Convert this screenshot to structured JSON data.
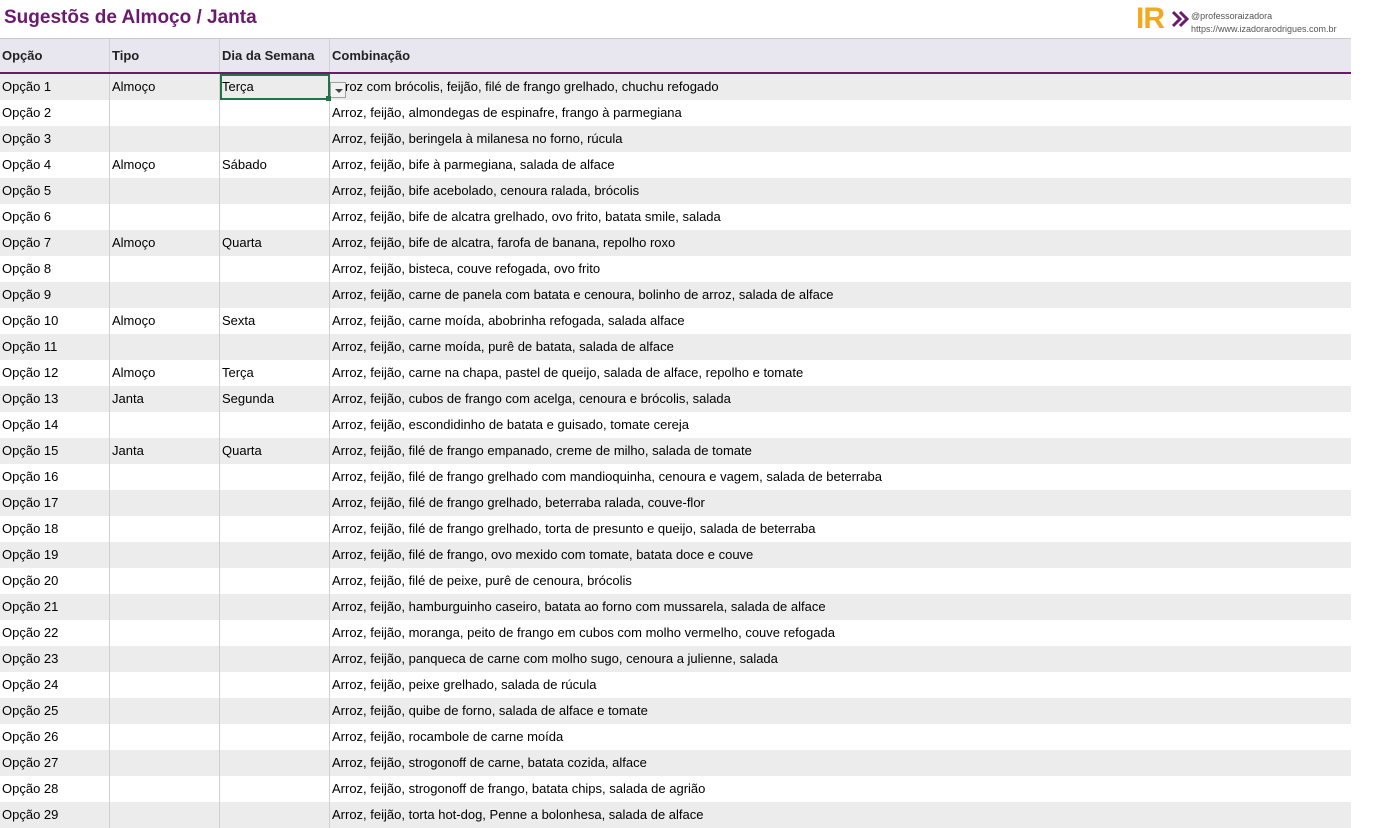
{
  "page": {
    "title": "Sugestõs de Almoço / Janta",
    "logo_mark": "IR",
    "logo_handle": "@professoraizadora",
    "logo_site": "https://www.izadorarodrigues.com.br",
    "brand_color": "#6b1b6e",
    "accent_color": "#f2a91d"
  },
  "table": {
    "headers": [
      "Opção",
      "Tipo",
      "Dia da Semana",
      "Combinação"
    ],
    "rows": [
      {
        "opcao": "Opção 1",
        "tipo": "Almoço",
        "dia": "Terça",
        "combinacao": "Arroz com brócolis, feijão, filé de frango grelhado, chuchu refogado"
      },
      {
        "opcao": "Opção 2",
        "tipo": "",
        "dia": "",
        "combinacao": "Arroz, feijão, almondegas de espinafre, frango à parmegiana"
      },
      {
        "opcao": "Opção 3",
        "tipo": "",
        "dia": "",
        "combinacao": "Arroz, feijão, beringela à milanesa no forno, rúcula"
      },
      {
        "opcao": "Opção 4",
        "tipo": "Almoço",
        "dia": "Sábado",
        "combinacao": "Arroz, feijão, bife à parmegiana, salada de alface"
      },
      {
        "opcao": "Opção 5",
        "tipo": "",
        "dia": "",
        "combinacao": "Arroz, feijão, bife acebolado, cenoura ralada, brócolis"
      },
      {
        "opcao": "Opção 6",
        "tipo": "",
        "dia": "",
        "combinacao": "Arroz, feijão, bife de alcatra grelhado, ovo frito, batata smile, salada"
      },
      {
        "opcao": "Opção 7",
        "tipo": "Almoço",
        "dia": "Quarta",
        "combinacao": "Arroz, feijão, bife de alcatra, farofa de banana, repolho roxo"
      },
      {
        "opcao": "Opção 8",
        "tipo": "",
        "dia": "",
        "combinacao": "Arroz, feijão, bisteca, couve refogada, ovo frito"
      },
      {
        "opcao": "Opção 9",
        "tipo": "",
        "dia": "",
        "combinacao": "Arroz, feijão, carne de panela com batata e cenoura, bolinho de arroz, salada de alface"
      },
      {
        "opcao": "Opção 10",
        "tipo": "Almoço",
        "dia": "Sexta",
        "combinacao": "Arroz, feijão, carne moída, abobrinha refogada, salada alface"
      },
      {
        "opcao": "Opção 11",
        "tipo": "",
        "dia": "",
        "combinacao": "Arroz, feijão, carne moída, purê de batata, salada de alface"
      },
      {
        "opcao": "Opção 12",
        "tipo": "Almoço",
        "dia": "Terça",
        "combinacao": "Arroz, feijão, carne na chapa, pastel de queijo, salada de alface, repolho e tomate"
      },
      {
        "opcao": "Opção 13",
        "tipo": "Janta",
        "dia": "Segunda",
        "combinacao": "Arroz, feijão, cubos de frango com acelga, cenoura e brócolis, salada"
      },
      {
        "opcao": "Opção 14",
        "tipo": "",
        "dia": "",
        "combinacao": "Arroz, feijão, escondidinho de batata e guisado, tomate cereja"
      },
      {
        "opcao": "Opção 15",
        "tipo": "Janta",
        "dia": "Quarta",
        "combinacao": "Arroz, feijão, filé de frango empanado, creme de milho, salada de tomate"
      },
      {
        "opcao": "Opção 16",
        "tipo": "",
        "dia": "",
        "combinacao": "Arroz, feijão, filé de frango grelhado com mandioquinha, cenoura e vagem, salada de beterraba"
      },
      {
        "opcao": "Opção 17",
        "tipo": "",
        "dia": "",
        "combinacao": "Arroz, feijão, filé de frango grelhado, beterraba ralada, couve-flor"
      },
      {
        "opcao": "Opção 18",
        "tipo": "",
        "dia": "",
        "combinacao": "Arroz, feijão, filé de frango grelhado, torta de presunto e queijo, salada de beterraba"
      },
      {
        "opcao": "Opção 19",
        "tipo": "",
        "dia": "",
        "combinacao": "Arroz, feijão, filé de frango, ovo mexido com tomate, batata doce e couve"
      },
      {
        "opcao": "Opção 20",
        "tipo": "",
        "dia": "",
        "combinacao": "Arroz, feijão, filé de peixe, purê de cenoura, brócolis"
      },
      {
        "opcao": "Opção 21",
        "tipo": "",
        "dia": "",
        "combinacao": "Arroz, feijão, hamburguinho caseiro, batata ao forno com mussarela, salada de alface"
      },
      {
        "opcao": "Opção 22",
        "tipo": "",
        "dia": "",
        "combinacao": "Arroz, feijão, moranga, peito de frango em cubos com molho vermelho, couve refogada"
      },
      {
        "opcao": "Opção 23",
        "tipo": "",
        "dia": "",
        "combinacao": "Arroz, feijão, panqueca de carne com molho sugo, cenoura a julienne, salada"
      },
      {
        "opcao": "Opção 24",
        "tipo": "",
        "dia": "",
        "combinacao": "Arroz, feijão, peixe grelhado, salada de rúcula"
      },
      {
        "opcao": "Opção 25",
        "tipo": "",
        "dia": "",
        "combinacao": "Arroz, feijão, quibe de forno, salada de alface e tomate"
      },
      {
        "opcao": "Opção 26",
        "tipo": "",
        "dia": "",
        "combinacao": "Arroz, feijão, rocambole de carne moída"
      },
      {
        "opcao": "Opção 27",
        "tipo": "",
        "dia": "",
        "combinacao": "Arroz, feijão, strogonoff de carne, batata cozida, alface"
      },
      {
        "opcao": "Opção 28",
        "tipo": "",
        "dia": "",
        "combinacao": "Arroz, feijão, strogonoff de frango, batata chips, salada de agrião"
      },
      {
        "opcao": "Opção 29",
        "tipo": "",
        "dia": "",
        "combinacao": "Arroz, feijão, torta hot-dog, Penne a bolonhesa, salada de alface"
      }
    ]
  }
}
